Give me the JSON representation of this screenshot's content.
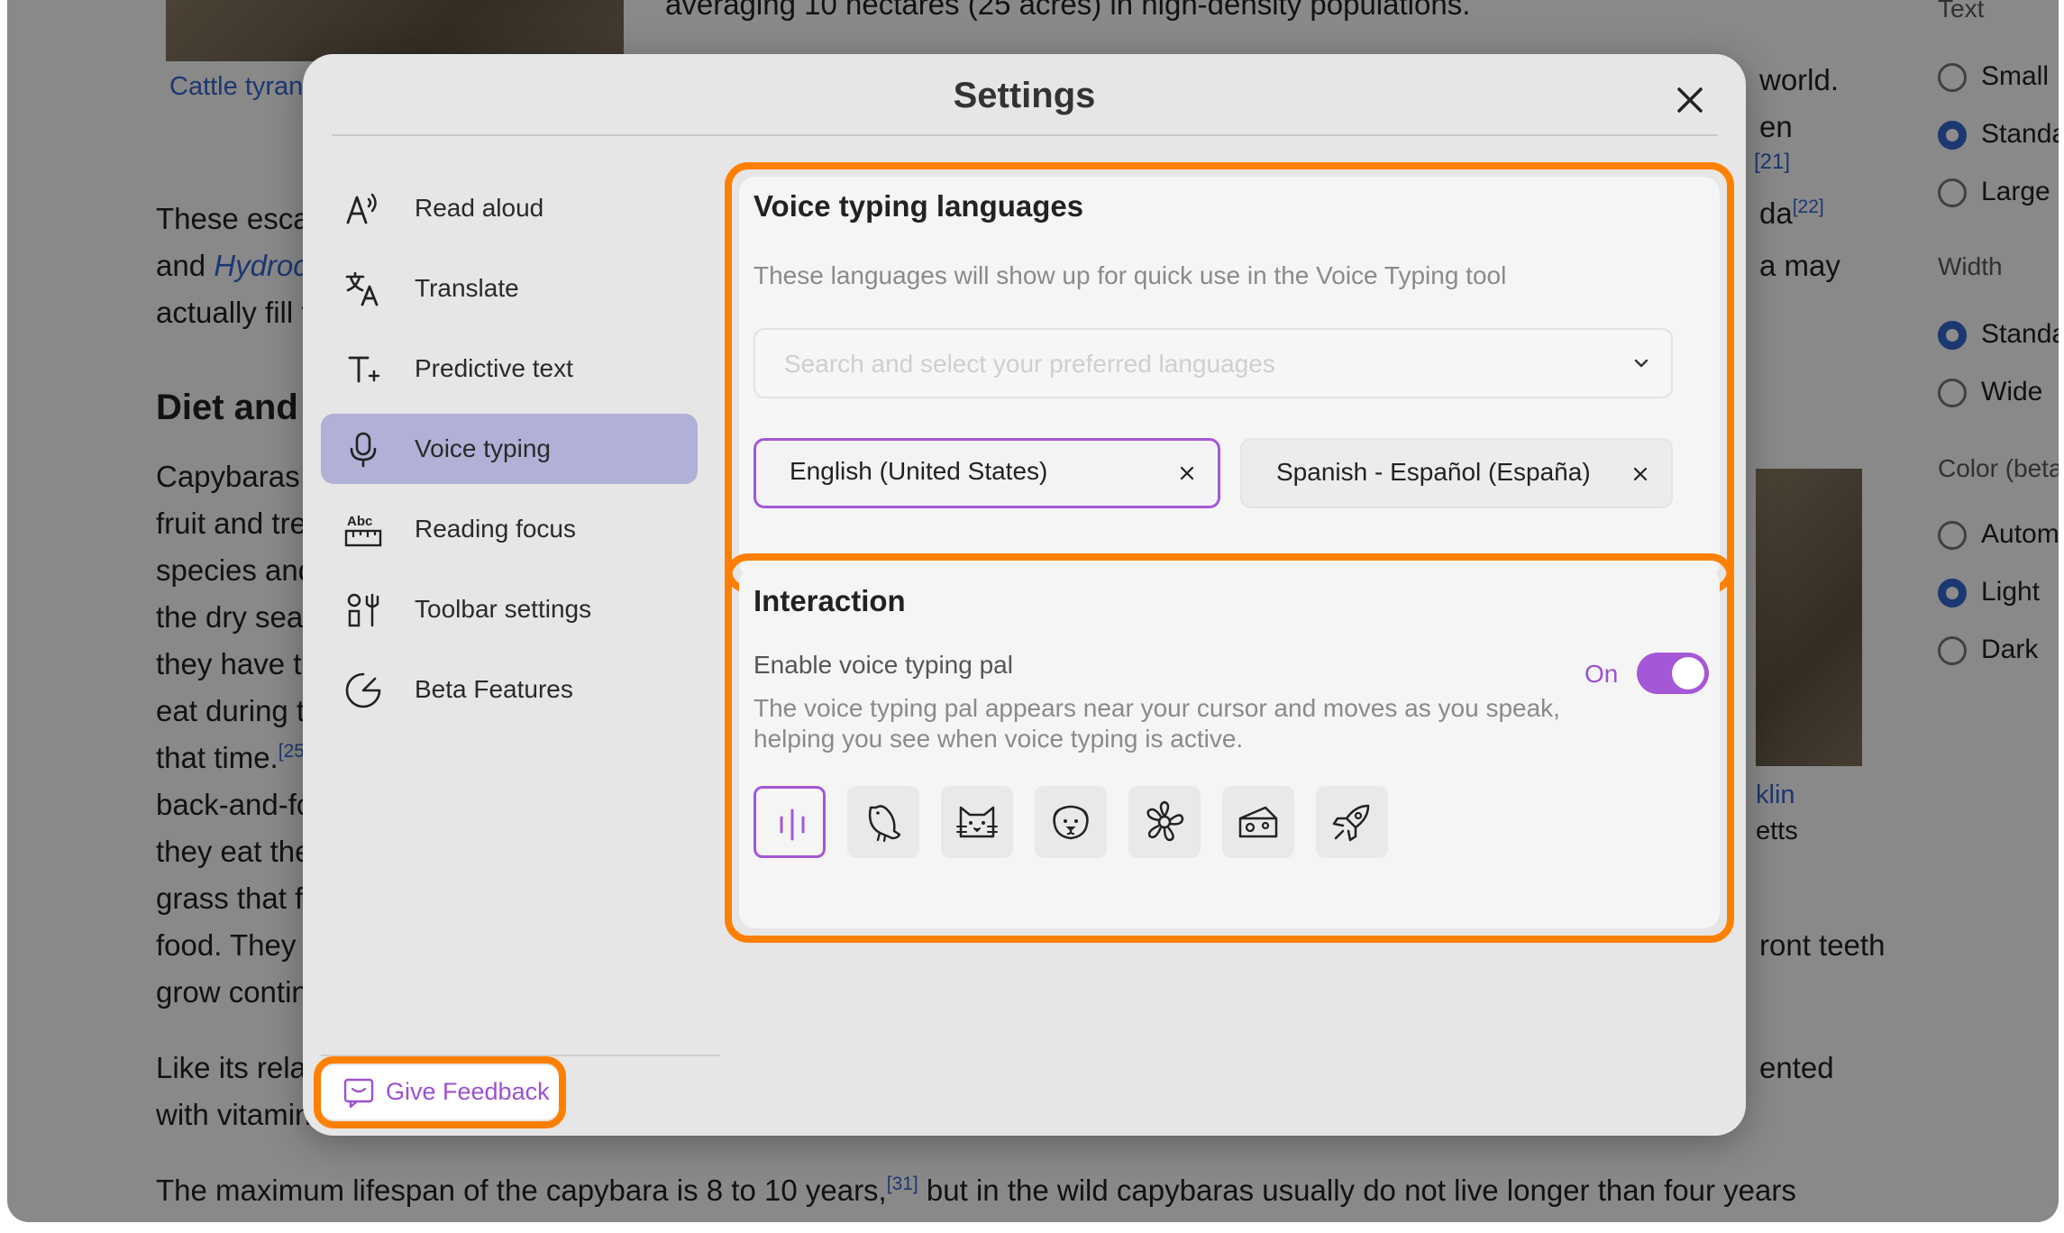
{
  "background": {
    "top_line": "averaging 10 hectares (25 acres) in high-density populations.",
    "caption_link": "Cattle tyrant",
    "para1": [
      "These esca",
      "and ",
      "actually fill t"
    ],
    "para1_link": "Hydroc",
    "heading": "Diet and",
    "para2": [
      "Capybaras",
      "fruit and tre",
      "species and",
      "the dry seas",
      "they have t",
      "eat during t",
      "that time.",
      "back-and-fo",
      "they eat the",
      "grass that f",
      "food. They",
      "grow contin"
    ],
    "para2_ref": "[25",
    "para3": [
      "Like its rela",
      "with vitamin"
    ],
    "bottom_line_a": "The maximum lifespan of the capybara is 8 to 10 years,",
    "bottom_ref": "[31]",
    "bottom_line_b": " but in the wild capybaras usually do not live longer than four years",
    "right_fragments": [
      "world.",
      "en",
      "[21]",
      "da",
      "[22]",
      "a may",
      "ront teeth",
      "ented"
    ],
    "right_caption": [
      "klin",
      "etts"
    ],
    "sidebar": {
      "text_heading": "Text",
      "text_options": [
        "Small",
        "Standa",
        "Large"
      ],
      "width_heading": "Width",
      "width_options": [
        "Standa",
        "Wide"
      ],
      "color_heading": "Color (beta",
      "color_options": [
        "Autom",
        "Light",
        "Dark"
      ]
    }
  },
  "modal": {
    "title": "Settings",
    "nav": [
      {
        "label": "Read aloud",
        "icon": "read-aloud-icon"
      },
      {
        "label": "Translate",
        "icon": "translate-icon"
      },
      {
        "label": "Predictive text",
        "icon": "predictive-text-icon"
      },
      {
        "label": "Voice typing",
        "icon": "microphone-icon",
        "active": true
      },
      {
        "label": "Reading focus",
        "icon": "ruler-icon"
      },
      {
        "label": "Toolbar settings",
        "icon": "toolbar-icon"
      },
      {
        "label": "Beta Features",
        "icon": "beta-icon"
      }
    ],
    "feedback_label": "Give Feedback",
    "languages": {
      "title": "Voice typing languages",
      "description": "These languages will show up for quick use in the Voice Typing tool",
      "placeholder": "Search and select your preferred languages",
      "chips": [
        "English (United States)",
        "Spanish - Español (España)"
      ]
    },
    "interaction": {
      "title": "Interaction",
      "toggle_title": "Enable voice typing pal",
      "toggle_state": "On",
      "description": [
        "The voice typing pal appears near your cursor and moves as you speak,",
        "helping you see when voice typing is active."
      ],
      "pals": [
        "audio-bars-icon",
        "bird-icon",
        "cat-icon",
        "dog-icon",
        "flower-icon",
        "cheese-icon",
        "rocket-icon"
      ],
      "selected_pal": 0
    },
    "accent_color": "#a457d7",
    "highlight_color": "#ff8000"
  }
}
